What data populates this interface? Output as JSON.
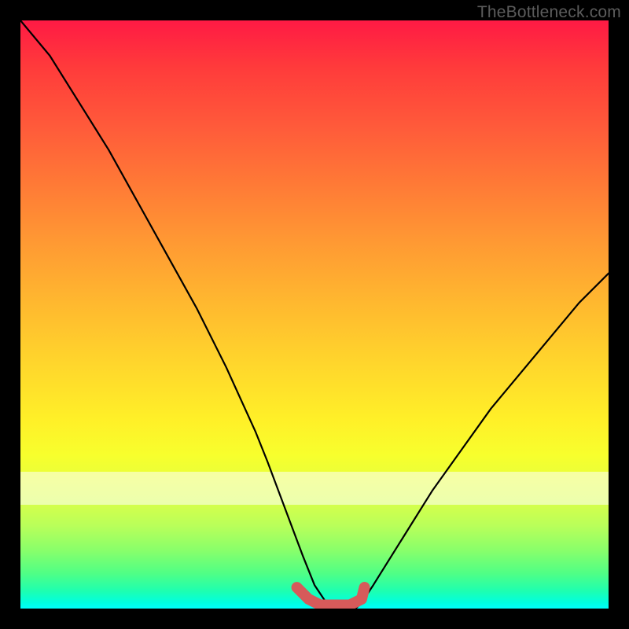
{
  "watermark": "TheBottleneck.com",
  "chart_data": {
    "type": "line",
    "title": "",
    "xlabel": "",
    "ylabel": "",
    "xlim": [
      0,
      100
    ],
    "ylim": [
      0,
      100
    ],
    "grid": false,
    "series": [
      {
        "name": "primary-curve",
        "x": [
          0,
          5,
          10,
          15,
          20,
          25,
          30,
          35,
          40,
          42,
          45,
          48,
          50,
          52,
          55,
          57,
          58,
          60,
          65,
          70,
          75,
          80,
          85,
          90,
          95,
          100
        ],
        "y": [
          100,
          94,
          86,
          78,
          69,
          60,
          51,
          41,
          30,
          25,
          17,
          9,
          4,
          1,
          0,
          0,
          1,
          4,
          12,
          20,
          27,
          34,
          40,
          46,
          52,
          57
        ]
      },
      {
        "name": "highlight-segment",
        "x": [
          47,
          49,
          51,
          54,
          56,
          58,
          58.5
        ],
        "y": [
          3.6,
          1.6,
          0.6,
          0.6,
          0.6,
          1.6,
          3.6
        ]
      }
    ],
    "colors": {
      "primary-curve": "#000000",
      "highlight-segment": "#d65a5a"
    }
  }
}
